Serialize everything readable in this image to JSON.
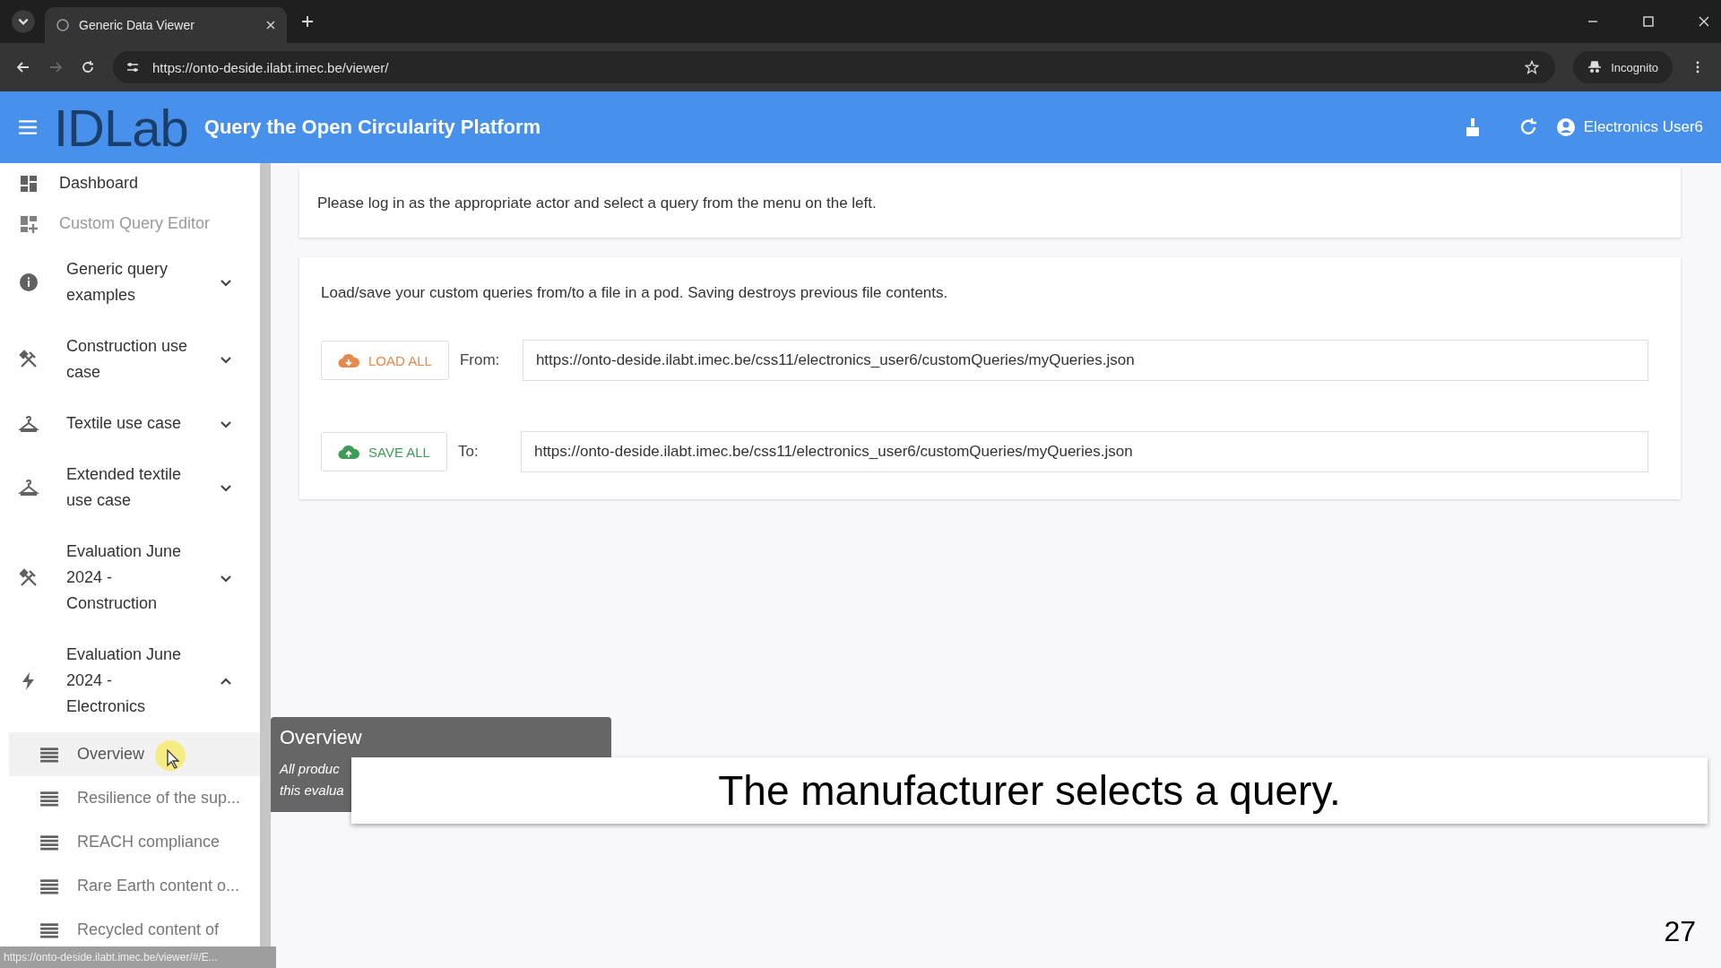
{
  "browser": {
    "tab_title": "Generic Data Viewer",
    "url": "https://onto-deside.ilabt.imec.be/viewer/",
    "incognito_label": "Incognito"
  },
  "header": {
    "logo": "IDLab",
    "title": "Query the Open Circularity Platform",
    "user": "Electronics User6"
  },
  "sidebar": {
    "links": [
      {
        "label": "Dashboard",
        "disabled": false
      },
      {
        "label": "Custom Query Editor",
        "disabled": true
      }
    ],
    "groups": [
      {
        "label": "Generic query examples",
        "expanded": false
      },
      {
        "label": "Construction use case",
        "expanded": false
      },
      {
        "label": "Textile use case",
        "expanded": false
      },
      {
        "label": "Extended textile use case",
        "expanded": false
      },
      {
        "label": "Evaluation June 2024 - Construction",
        "expanded": false
      },
      {
        "label": "Evaluation June 2024 - Electronics",
        "expanded": true,
        "children": [
          {
            "label": "Overview",
            "selected": true
          },
          {
            "label": "Resilience of the sup...",
            "selected": false
          },
          {
            "label": "REACH compliance",
            "selected": false
          },
          {
            "label": "Rare Earth content o...",
            "selected": false
          },
          {
            "label": "Recycled content of",
            "selected": false
          }
        ]
      }
    ]
  },
  "notice": "Please log in as the appropriate actor and select a query from the menu on the left.",
  "load_save": {
    "intro": "Load/save your custom queries from/to a file in a pod. Saving destroys previous file contents.",
    "rows": [
      {
        "kind": "load",
        "button": "LOAD ALL",
        "label": "From:",
        "value": "https://onto-deside.ilabt.imec.be/css11/electronics_user6/customQueries/myQueries.json"
      },
      {
        "kind": "save",
        "button": "SAVE ALL",
        "label": "To:",
        "value": "https://onto-deside.ilabt.imec.be/css11/electronics_user6/customQueries/myQueries.json"
      }
    ]
  },
  "tooltip": {
    "title": "Overview",
    "lines": [
      "All produc",
      "this evalua"
    ]
  },
  "caption": "The manufacturer selects a query.",
  "slide_number": "27",
  "status_link": "https://onto-deside.ilabt.imec.be/viewer/#/E..."
}
